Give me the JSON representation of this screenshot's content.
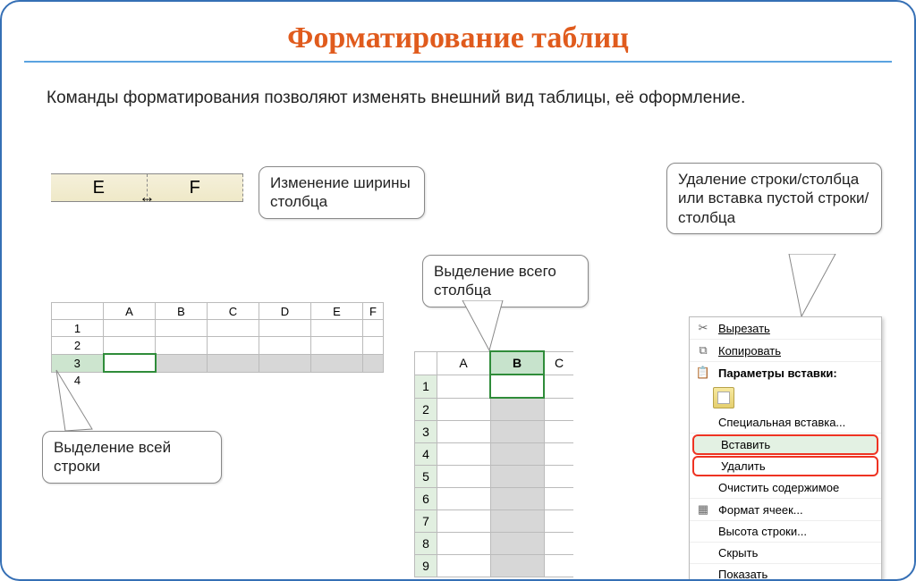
{
  "title": "Форматирование таблиц",
  "subtitle": "Команды форматирования позволяют изменять внешний вид таблицы, её оформление.",
  "callouts": {
    "colwidth": "Изменение ширины столбца",
    "selrow": "Выделение всей строки",
    "selcol": "Выделение всего столбца",
    "delins": "Удаление строки/столбца или вставка пустой строки/столбца"
  },
  "colwidth_headers": [
    "E",
    "F"
  ],
  "table1": {
    "cols": [
      "A",
      "B",
      "C",
      "D",
      "E",
      "F"
    ],
    "rows": [
      "1",
      "2",
      "3",
      "4"
    ],
    "selected_row": "3"
  },
  "table2": {
    "cols": [
      "A",
      "B",
      "C"
    ],
    "rows": [
      "1",
      "2",
      "3",
      "4",
      "5",
      "6",
      "7",
      "8",
      "9"
    ],
    "selected_col": "B"
  },
  "context_menu": {
    "cut": "Вырезать",
    "copy": "Копировать",
    "paste_params": "Параметры вставки:",
    "special_paste": "Специальная вставка...",
    "insert": "Вставить",
    "delete": "Удалить",
    "clear": "Очистить содержимое",
    "format_cells": "Формат ячеек...",
    "row_height": "Высота строки...",
    "hide": "Скрыть",
    "show": "Показать"
  }
}
